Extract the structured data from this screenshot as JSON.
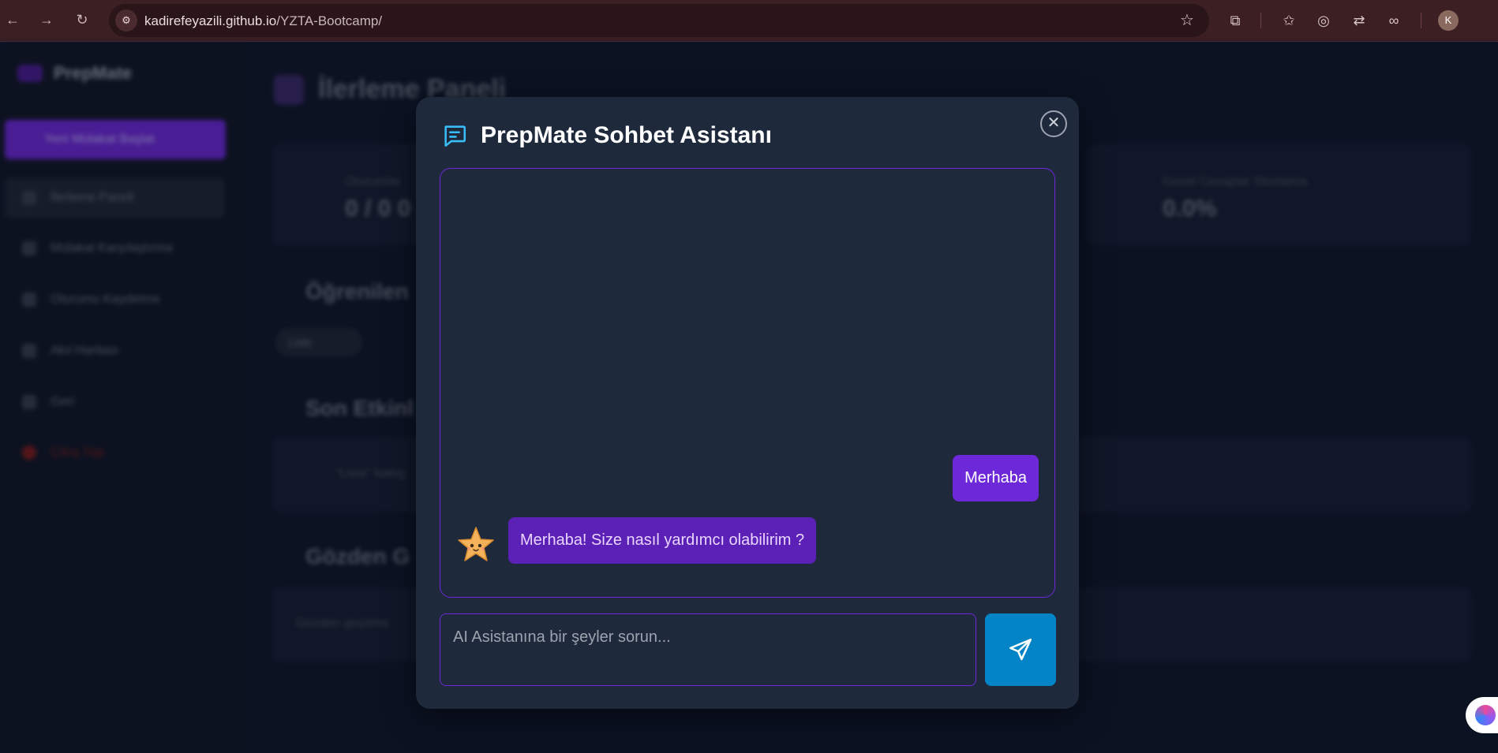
{
  "browser": {
    "url_host": "kadirefeyazili.github.io",
    "url_path": "/YZTA-Bootcamp/",
    "profile_initial": "K"
  },
  "background": {
    "brand_name": "PrepMate",
    "cta_label": "Yeni Mülakat Başlat",
    "sidebar_items": [
      {
        "label": "İlerleme Paneli"
      },
      {
        "label": "Mülakat Karşılaştırma"
      },
      {
        "label": "Oturumu Kaydetme"
      },
      {
        "label": "Akıl Haritası"
      },
      {
        "label": "Geri"
      },
      {
        "label": "Çıkış Yap"
      }
    ],
    "page_title": "İlerleme Paneli",
    "card1_label": "Oturumlar",
    "card1_value": "0 / 0 0",
    "card2_label": "Genel Cevaplar Skorlama",
    "card2_value": "0.0%",
    "section1": "Öğrenilen",
    "pill_label": "Liste",
    "section2": "Son Etkinl",
    "activity_text": "\"Liste\" kateg",
    "section3": "Gözden G",
    "review_text": "Gözden geçirme"
  },
  "modal": {
    "title": "PrepMate Sohbet Asistanı",
    "messages": {
      "user": "Merhaba",
      "bot": "Merhaba! Size nasıl yardımcı olabilirim ?"
    },
    "input_placeholder": "AI Asistanına bir şeyler sorun..."
  },
  "colors": {
    "accent": "#6d28d9",
    "send": "#0284c7",
    "modal_bg": "#1e293b"
  }
}
